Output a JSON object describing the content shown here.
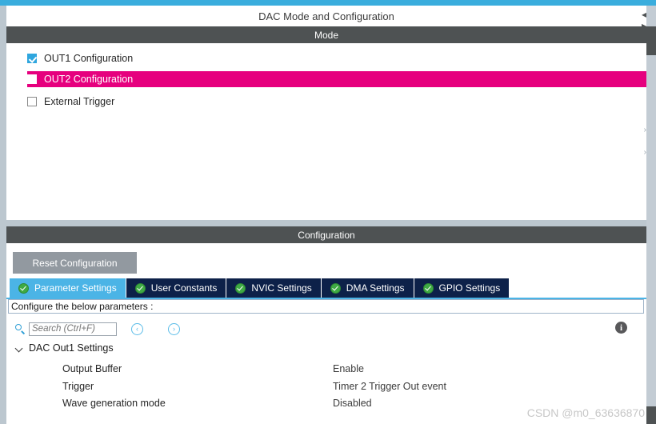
{
  "mode_panel": {
    "title": "DAC Mode and Configuration",
    "header": "Mode",
    "options": [
      {
        "label": "OUT1 Configuration",
        "checked": true,
        "selected": false
      },
      {
        "label": "OUT2 Configuration",
        "checked": false,
        "selected": true
      },
      {
        "label": "External Trigger",
        "checked": false,
        "selected": false
      }
    ]
  },
  "configuration_panel": {
    "header": "Configuration",
    "reset_button": "Reset Configuration",
    "tabs": [
      {
        "label": "Parameter Settings",
        "active": true,
        "icon": "green-check-icon"
      },
      {
        "label": "User Constants",
        "active": false,
        "icon": "green-check-icon"
      },
      {
        "label": "NVIC Settings",
        "active": false,
        "icon": "green-check-icon"
      },
      {
        "label": "DMA Settings",
        "active": false,
        "icon": "green-check-icon"
      },
      {
        "label": "GPIO Settings",
        "active": false,
        "icon": "green-check-icon"
      }
    ],
    "configure_bar": "Configure the below parameters :",
    "search": {
      "placeholder": "Search (Ctrl+F)",
      "value": "",
      "icon": "search-icon",
      "prev_icon": "‹",
      "next_icon": "›"
    },
    "info_icon_label": "i",
    "tree": {
      "group_label": "DAC Out1 Settings",
      "expanded": true,
      "rows": [
        {
          "name": "Output Buffer",
          "value": "Enable"
        },
        {
          "name": "Trigger",
          "value": "Timer 2 Trigger Out event"
        },
        {
          "name": "Wave generation mode",
          "value": "Disabled"
        }
      ]
    }
  },
  "watermark": "CSDN @m0_63636870",
  "colors": {
    "accent_blue": "#3aaddd",
    "selection_magenta": "#e6007e",
    "header_gray": "#4e5253",
    "tab_navy": "#0d2149",
    "tab_active_blue": "#4bb4e6",
    "check_green": "#3faa44",
    "checkbox_blue": "#2fa6de",
    "strip_gray": "#bcc7cf"
  }
}
